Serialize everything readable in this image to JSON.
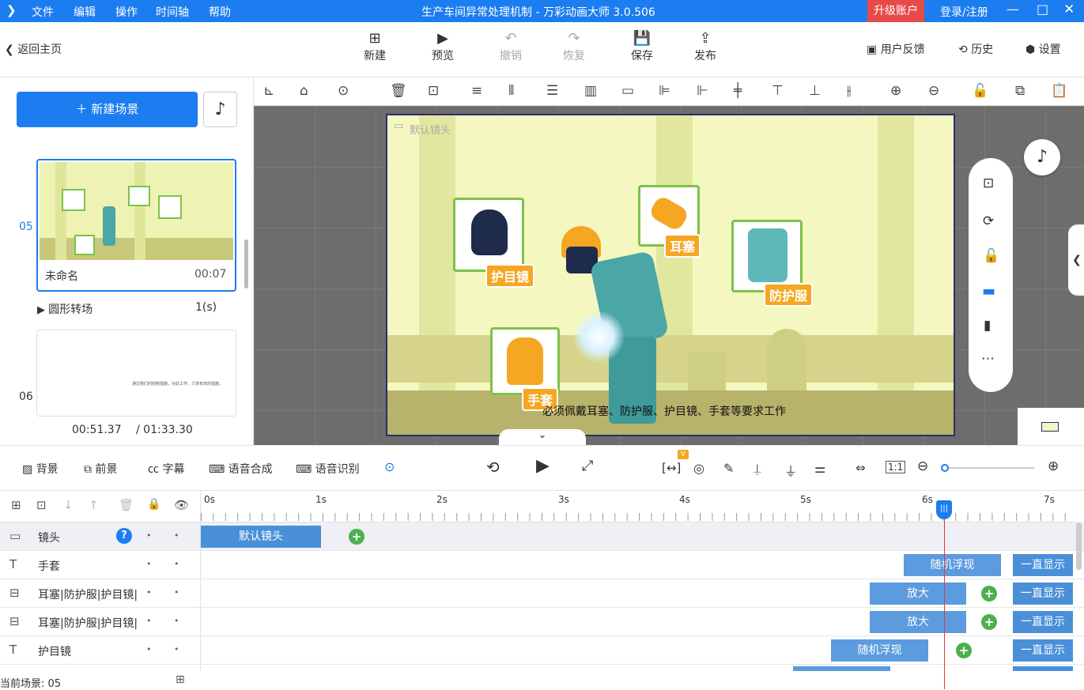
{
  "menu": [
    "文件",
    "编辑",
    "操作",
    "时间轴",
    "帮助"
  ],
  "window_title": "生产车间异常处理机制 - 万彩动画大师 3.0.506",
  "upgrade_label": "升级账户",
  "login_label": "登录/注册",
  "back_label": "返回主页",
  "toolbar": {
    "new": "新建",
    "preview": "预览",
    "undo": "撤销",
    "redo": "恢复",
    "save": "保存",
    "publish": "发布"
  },
  "right_tools": {
    "feedback": "用户反馈",
    "history": "历史",
    "settings": "设置"
  },
  "left": {
    "new_scene": "新建场景",
    "scene_05_index": "05",
    "scene_05_name": "未命名",
    "scene_05_duration": "00:07",
    "transition_name": "圆形转场",
    "transition_duration": "1(s)",
    "scene_06_index": "06",
    "scene_06_text": "通过我们的控制措施，对此工作，力求有效的措施。",
    "time_current": "00:51.37",
    "time_total": "/ 01:33.30"
  },
  "stage": {
    "camera_label": "默认镜头",
    "tag_goggles": "护目镜",
    "tag_earplugs": "耳塞",
    "tag_suit": "防护服",
    "tag_gloves": "手套",
    "caption": "必须佩戴耳塞、防护服、护目镜、手套等要求工作"
  },
  "ctrl": {
    "background": "背景",
    "foreground": "前景",
    "subtitle": "字幕",
    "tts": "语音合成",
    "asr": "语音识别"
  },
  "ruler": [
    "0s",
    "1s",
    "2s",
    "3s",
    "4s",
    "5s",
    "6s",
    "7s"
  ],
  "tracks": [
    {
      "icon": "camera",
      "name": "镜头"
    },
    {
      "icon": "text",
      "name": "手套"
    },
    {
      "icon": "group",
      "name": "耳塞|防护服|护目镜|"
    },
    {
      "icon": "group",
      "name": "耳塞|防护服|护目镜|"
    },
    {
      "icon": "text",
      "name": "护目镜"
    }
  ],
  "clips": {
    "camera": "默认镜头",
    "random_float": "随机浮现",
    "zoom": "放大",
    "always_show": "一直显示"
  },
  "status": "当前场景: 05"
}
